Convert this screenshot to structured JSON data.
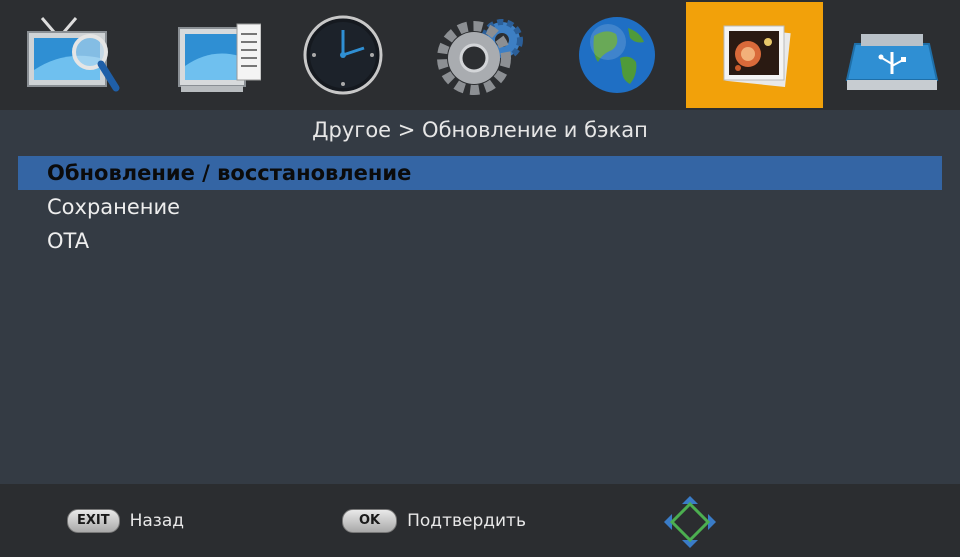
{
  "top_tabs": [
    {
      "icon": "tv-search-icon",
      "active": false
    },
    {
      "icon": "tv-guide-icon",
      "active": false
    },
    {
      "icon": "clock-icon",
      "active": false
    },
    {
      "icon": "gears-icon",
      "active": false
    },
    {
      "icon": "globe-icon",
      "active": false
    },
    {
      "icon": "media-photo-icon",
      "active": true
    },
    {
      "icon": "usb-drive-icon",
      "active": false
    }
  ],
  "breadcrumb": "Другое > Обновление и бэкап",
  "menu": [
    {
      "label": "Обновление / восстановление",
      "selected": true
    },
    {
      "label": "Сохранение",
      "selected": false
    },
    {
      "label": "OTA",
      "selected": false
    }
  ],
  "footer": {
    "exit_key": "EXIT",
    "exit_label": "Назад",
    "ok_key": "OK",
    "ok_label": "Подтвердить"
  },
  "colors": {
    "active_tab": "#f2a10a",
    "selection": "#3465a4",
    "background": "#343b44"
  }
}
